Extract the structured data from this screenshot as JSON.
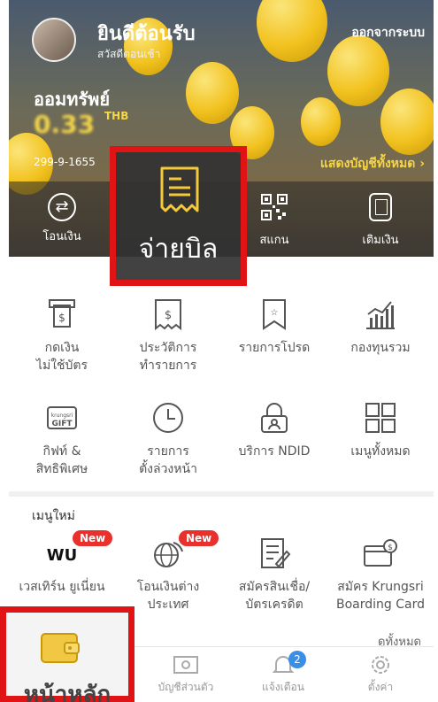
{
  "header": {
    "welcome": "ยินดีต้อนรับ",
    "greeting": "สวัสดีตอนเช้า",
    "logout_label": "ออกจากระบบ"
  },
  "account": {
    "name": "ออมทรัพย์",
    "balance": "0.33",
    "currency": "THB",
    "number": "299-9-1655",
    "show_all_label": "แสดงบัญชีทั้งหมด"
  },
  "quick_actions": [
    {
      "label": "โอนเงิน",
      "icon": "transfer-icon"
    },
    {
      "label": "จ่ายบิล",
      "icon": "receipt-icon"
    },
    {
      "label": "สแกน",
      "icon": "qr-scan-icon"
    },
    {
      "label": "เติมเงิน",
      "icon": "topup-icon"
    }
  ],
  "menu": [
    {
      "label": "กดเงิน\nไม่ใช้บัตร",
      "icon": "cardless-withdraw-icon"
    },
    {
      "label": "ประวัติการ\nทำรายการ",
      "icon": "transaction-history-icon"
    },
    {
      "label": "รายการโปรด",
      "icon": "favorite-icon"
    },
    {
      "label": "กองทุนรวม",
      "icon": "mutual-fund-icon"
    },
    {
      "label": "กิฟท์ &\nสิทธิพิเศษ",
      "icon": "gift-icon"
    },
    {
      "label": "รายการ\nตั้งล่วงหน้า",
      "icon": "schedule-icon"
    },
    {
      "label": "บริการ NDID",
      "icon": "ndid-icon"
    },
    {
      "label": "เมนูทั้งหมด",
      "icon": "all-menu-icon"
    }
  ],
  "gift_icon_text": {
    "top": "krungsri",
    "bottom": "GIFT"
  },
  "new_menu": {
    "title": "เมนูใหม่",
    "see_all": "ดูทั้งหมด",
    "badge": "New",
    "items": [
      {
        "label": "เวสเทิร์น ยูเนี่ยน",
        "logo": "WU",
        "icon": "western-union-icon"
      },
      {
        "label": "โอนเงินต่าง\nประเทศ",
        "icon": "global-transfer-icon"
      },
      {
        "label": "สมัครสินเชื่อ/\nบัตรเครดิต",
        "icon": "loan-apply-icon"
      },
      {
        "label": "สมัคร Krungsri\nBoarding Card",
        "icon": "boarding-card-icon"
      }
    ]
  },
  "bottom_nav": {
    "items": [
      {
        "label": "หน้าหลัก",
        "icon": "wallet-icon"
      },
      {
        "label": "บัญชีส่วนตัว",
        "icon": "account-icon"
      },
      {
        "label": "แจ้งเตือน",
        "icon": "bell-icon",
        "badge": "2"
      },
      {
        "label": "ตั้งค่า",
        "icon": "gear-icon"
      }
    ]
  },
  "colors": {
    "accent_yellow": "#f5d64a",
    "highlight_red": "#e01414",
    "badge_red": "#e8312c",
    "notif_blue": "#3a8ee6"
  }
}
